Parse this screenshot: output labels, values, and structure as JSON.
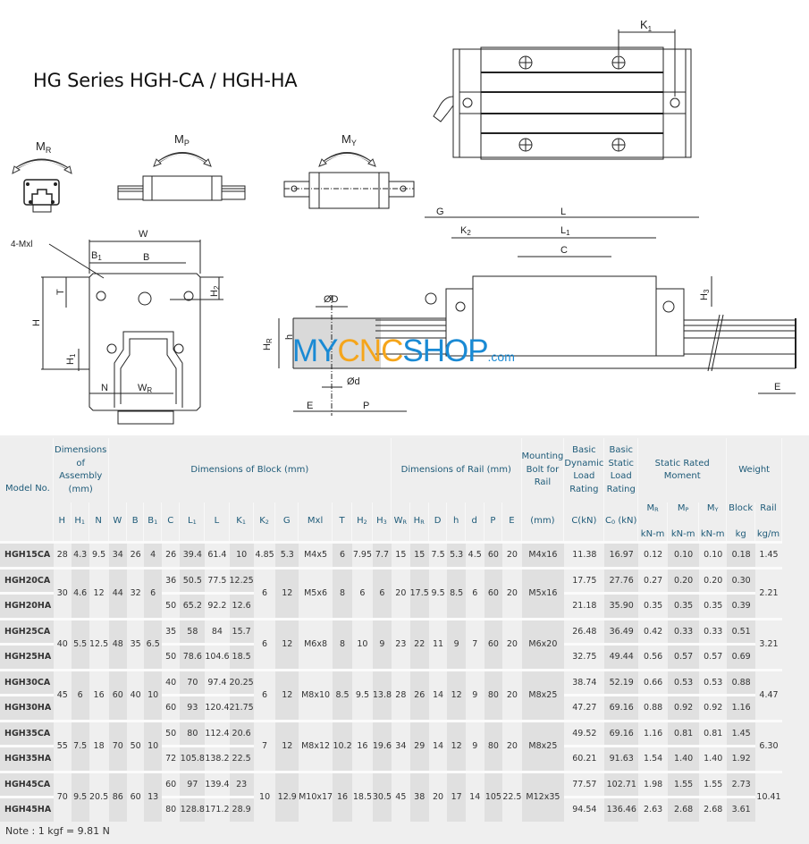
{
  "title": "HG Series  HGH-CA / HGH-HA",
  "watermark": {
    "part1": "MY",
    "part2": "CN",
    "part3": "C",
    "part4": "SHOP",
    "suffix": ".com"
  },
  "diagram_labels": {
    "mr": "M",
    "mr_sub": "R",
    "mp": "M",
    "mp_sub": "P",
    "my": "M",
    "my_sub": "Y",
    "k1": "K",
    "k1_sub": "1",
    "w": "W",
    "b": "B",
    "b1": "B",
    "b1_sub": "1",
    "mxl": "4-Mxl",
    "t": "T",
    "h": "H",
    "h1": "H",
    "h1_sub": "1",
    "h2": "H",
    "h2_sub": "2",
    "n": "N",
    "wr": "W",
    "wr_sub": "R",
    "od": "ØD",
    "hs": "h",
    "hr": "H",
    "hr_sub": "R",
    "d": "Ød",
    "e": "E",
    "p": "P",
    "g": "G",
    "l": "L",
    "k2": "K",
    "k2_sub": "2",
    "l1": "L",
    "l1_sub": "1",
    "c": "C",
    "h3": "H",
    "h3_sub": "3",
    "e2": "E"
  },
  "table": {
    "headers": {
      "model": "Model No.",
      "assembly": "Dimensions of Assembly (mm)",
      "block": "Dimensions of Block (mm)",
      "rail": "Dimensions of Rail (mm)",
      "bolt": "Mounting Bolt for Rail",
      "dynamic": "Basic Dynamic Load Rating",
      "static": "Basic Static Load Rating",
      "moment": "Static Rated Moment",
      "weight": "Weight",
      "mr": "M",
      "mr_sub": "R",
      "mp": "M",
      "mp_sub": "P",
      "my": "M",
      "my_sub": "Y",
      "block_w": "Block",
      "rail_w": "Rail"
    },
    "sub_headers": [
      {
        "t": "H",
        "s": ""
      },
      {
        "t": "H",
        "s": "1"
      },
      {
        "t": "N",
        "s": ""
      },
      {
        "t": "W",
        "s": ""
      },
      {
        "t": "B",
        "s": ""
      },
      {
        "t": "B",
        "s": "1"
      },
      {
        "t": "C",
        "s": ""
      },
      {
        "t": "L",
        "s": "1"
      },
      {
        "t": "L",
        "s": ""
      },
      {
        "t": "K",
        "s": "1"
      },
      {
        "t": "K",
        "s": "2"
      },
      {
        "t": "G",
        "s": ""
      },
      {
        "t": "Mxl",
        "s": ""
      },
      {
        "t": "T",
        "s": ""
      },
      {
        "t": "H",
        "s": "2"
      },
      {
        "t": "H",
        "s": "3"
      },
      {
        "t": "W",
        "s": "R"
      },
      {
        "t": "H",
        "s": "R"
      },
      {
        "t": "D",
        "s": ""
      },
      {
        "t": "h",
        "s": ""
      },
      {
        "t": "d",
        "s": ""
      },
      {
        "t": "P",
        "s": ""
      },
      {
        "t": "E",
        "s": ""
      },
      {
        "t": "(mm)",
        "s": ""
      },
      {
        "t": "C(kN)",
        "s": ""
      },
      {
        "t": "C",
        "s": "0",
        "t2": " (kN)"
      },
      {
        "t": "kN-m",
        "s": ""
      },
      {
        "t": "kN-m",
        "s": ""
      },
      {
        "t": "kN-m",
        "s": ""
      },
      {
        "t": "kg",
        "s": ""
      },
      {
        "t": "kg/m",
        "s": ""
      }
    ],
    "groups": [
      {
        "shared": {
          "H": "28",
          "H1": "4.3",
          "N": "9.5",
          "W": "34",
          "B": "26",
          "B1": "4",
          "K2": "4.85",
          "G": "5.3",
          "Mxl": "M4x5",
          "T": "6",
          "H2": "7.95",
          "H3": "7.7",
          "WR": "15",
          "HR": "15",
          "D": "7.5",
          "h": "5.3",
          "d": "4.5",
          "P": "60",
          "E": "20",
          "bolt": "M4x16",
          "rail_kg": "1.45"
        },
        "rows": [
          {
            "model": "HGH15CA",
            "C": "26",
            "L1": "39.4",
            "L": "61.4",
            "K1": "10",
            "Cdyn": "11.38",
            "C0": "16.97",
            "MR": "0.12",
            "MP": "0.10",
            "MY": "0.10",
            "block_kg": "0.18"
          }
        ]
      },
      {
        "shared": {
          "H": "30",
          "H1": "4.6",
          "N": "12",
          "W": "44",
          "B": "32",
          "B1": "6",
          "K2": "6",
          "G": "12",
          "Mxl": "M5x6",
          "T": "8",
          "H2": "6",
          "H3": "6",
          "WR": "20",
          "HR": "17.5",
          "D": "9.5",
          "h": "8.5",
          "d": "6",
          "P": "60",
          "E": "20",
          "bolt": "M5x16",
          "rail_kg": "2.21"
        },
        "rows": [
          {
            "model": "HGH20CA",
            "C": "36",
            "L1": "50.5",
            "L": "77.5",
            "K1": "12.25",
            "Cdyn": "17.75",
            "C0": "27.76",
            "MR": "0.27",
            "MP": "0.20",
            "MY": "0.20",
            "block_kg": "0.30"
          },
          {
            "model": "HGH20HA",
            "C": "50",
            "L1": "65.2",
            "L": "92.2",
            "K1": "12.6",
            "Cdyn": "21.18",
            "C0": "35.90",
            "MR": "0.35",
            "MP": "0.35",
            "MY": "0.35",
            "block_kg": "0.39"
          }
        ]
      },
      {
        "shared": {
          "H": "40",
          "H1": "5.5",
          "N": "12.5",
          "W": "48",
          "B": "35",
          "B1": "6.5",
          "K2": "6",
          "G": "12",
          "Mxl": "M6x8",
          "T": "8",
          "H2": "10",
          "H3": "9",
          "WR": "23",
          "HR": "22",
          "D": "11",
          "h": "9",
          "d": "7",
          "P": "60",
          "E": "20",
          "bolt": "M6x20",
          "rail_kg": "3.21"
        },
        "rows": [
          {
            "model": "HGH25CA",
            "C": "35",
            "L1": "58",
            "L": "84",
            "K1": "15.7",
            "Cdyn": "26.48",
            "C0": "36.49",
            "MR": "0.42",
            "MP": "0.33",
            "MY": "0.33",
            "block_kg": "0.51"
          },
          {
            "model": "HGH25HA",
            "C": "50",
            "L1": "78.6",
            "L": "104.6",
            "K1": "18.5",
            "Cdyn": "32.75",
            "C0": "49.44",
            "MR": "0.56",
            "MP": "0.57",
            "MY": "0.57",
            "block_kg": "0.69"
          }
        ]
      },
      {
        "shared": {
          "H": "45",
          "H1": "6",
          "N": "16",
          "W": "60",
          "B": "40",
          "B1": "10",
          "K2": "6",
          "G": "12",
          "Mxl": "M8x10",
          "T": "8.5",
          "H2": "9.5",
          "H3": "13.8",
          "WR": "28",
          "HR": "26",
          "D": "14",
          "h": "12",
          "d": "9",
          "P": "80",
          "E": "20",
          "bolt": "M8x25",
          "rail_kg": "4.47"
        },
        "rows": [
          {
            "model": "HGH30CA",
            "C": "40",
            "L1": "70",
            "L": "97.4",
            "K1": "20.25",
            "Cdyn": "38.74",
            "C0": "52.19",
            "MR": "0.66",
            "MP": "0.53",
            "MY": "0.53",
            "block_kg": "0.88"
          },
          {
            "model": "HGH30HA",
            "C": "60",
            "L1": "93",
            "L": "120.4",
            "K1": "21.75",
            "Cdyn": "47.27",
            "C0": "69.16",
            "MR": "0.88",
            "MP": "0.92",
            "MY": "0.92",
            "block_kg": "1.16"
          }
        ]
      },
      {
        "shared": {
          "H": "55",
          "H1": "7.5",
          "N": "18",
          "W": "70",
          "B": "50",
          "B1": "10",
          "K2": "7",
          "G": "12",
          "Mxl": "M8x12",
          "T": "10.2",
          "H2": "16",
          "H3": "19.6",
          "WR": "34",
          "HR": "29",
          "D": "14",
          "h": "12",
          "d": "9",
          "P": "80",
          "E": "20",
          "bolt": "M8x25",
          "rail_kg": "6.30"
        },
        "rows": [
          {
            "model": "HGH35CA",
            "C": "50",
            "L1": "80",
            "L": "112.4",
            "K1": "20.6",
            "Cdyn": "49.52",
            "C0": "69.16",
            "MR": "1.16",
            "MP": "0.81",
            "MY": "0.81",
            "block_kg": "1.45"
          },
          {
            "model": "HGH35HA",
            "C": "72",
            "L1": "105.8",
            "L": "138.2",
            "K1": "22.5",
            "Cdyn": "60.21",
            "C0": "91.63",
            "MR": "1.54",
            "MP": "1.40",
            "MY": "1.40",
            "block_kg": "1.92"
          }
        ]
      },
      {
        "shared": {
          "H": "70",
          "H1": "9.5",
          "N": "20.5",
          "W": "86",
          "B": "60",
          "B1": "13",
          "K2": "10",
          "G": "12.9",
          "Mxl": "M10x17",
          "T": "16",
          "H2": "18.5",
          "H3": "30.5",
          "WR": "45",
          "HR": "38",
          "D": "20",
          "h": "17",
          "d": "14",
          "P": "105",
          "E": "22.5",
          "bolt": "M12x35",
          "rail_kg": "10.41"
        },
        "rows": [
          {
            "model": "HGH45CA",
            "C": "60",
            "L1": "97",
            "L": "139.4",
            "K1": "23",
            "Cdyn": "77.57",
            "C0": "102.71",
            "MR": "1.98",
            "MP": "1.55",
            "MY": "1.55",
            "block_kg": "2.73"
          },
          {
            "model": "HGH45HA",
            "C": "80",
            "L1": "128.8",
            "L": "171.2",
            "K1": "28.9",
            "Cdyn": "94.54",
            "C0": "136.46",
            "MR": "2.63",
            "MP": "2.68",
            "MY": "2.68",
            "block_kg": "3.61"
          }
        ]
      }
    ]
  },
  "note": "Note : 1 kgf = 9.81 N"
}
